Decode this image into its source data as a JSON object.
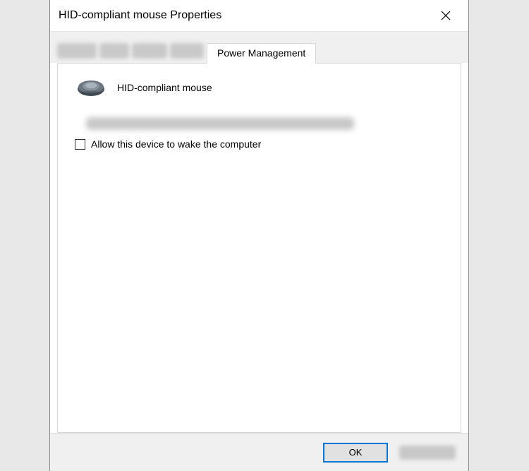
{
  "dialog": {
    "title": "HID-compliant mouse Properties"
  },
  "tabs": {
    "active": "Power Management"
  },
  "device": {
    "name": "HID-compliant mouse"
  },
  "options": {
    "wake_label": "Allow this device to wake the computer",
    "wake_checked": false
  },
  "buttons": {
    "ok": "OK"
  }
}
